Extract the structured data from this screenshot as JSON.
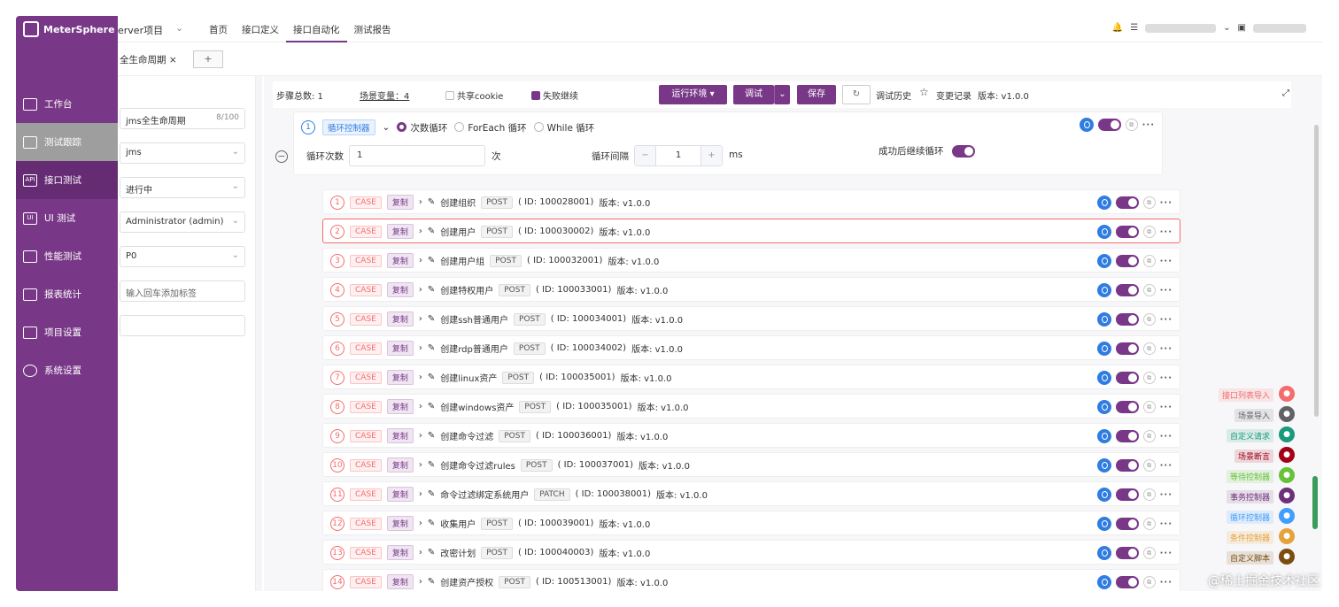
{
  "app": {
    "name": "MeterSphere"
  },
  "header": {
    "project": "erver项目",
    "nav": [
      "首页",
      "接口定义",
      "接口自动化",
      "测试报告"
    ],
    "active_nav": "接口自动化"
  },
  "tabs": {
    "current": "全生命周期 ×",
    "add": "+"
  },
  "sidebar": {
    "items": [
      {
        "label": "工作台",
        "icon": "desktop-icon"
      },
      {
        "label": "测试跟踪",
        "icon": "document-icon"
      },
      {
        "label": "接口测试",
        "icon": "api-icon"
      },
      {
        "label": "UI 测试",
        "icon": "ui-icon"
      },
      {
        "label": "性能测试",
        "icon": "performance-icon"
      },
      {
        "label": "报表统计",
        "icon": "report-icon"
      },
      {
        "label": "项目设置",
        "icon": "folder-icon"
      },
      {
        "label": "系统设置",
        "icon": "gear-icon"
      }
    ]
  },
  "form": {
    "name": "jms全生命周期",
    "name_count": "8/100",
    "module": "jms",
    "status": "进行中",
    "principal": "Administrator (admin)",
    "level": "P0",
    "tag_placeholder": "输入回车添加标签"
  },
  "toolbar": {
    "steps": "步骤总数: 1",
    "variables": "场景变量：4",
    "share_cookie": "共享cookie",
    "fail_continue": "失败继续",
    "env": "运行环境 ▾",
    "debug": "调试",
    "save": "保存",
    "history": "调试历史",
    "changelog": "变更记录",
    "version": "版本: v1.0.0"
  },
  "loop": {
    "index": "1",
    "tag": "循环控制器",
    "mode_count": "次数循环",
    "mode_foreach": "ForEach 循环",
    "mode_while": "While 循环",
    "count_label": "循环次数",
    "count_value": "1",
    "count_unit": "次",
    "interval_label": "循环间隔",
    "interval_value": "1",
    "interval_unit": "ms",
    "continue_label": "成功后继续循环"
  },
  "steps": [
    {
      "n": "1",
      "name": "创建组织",
      "method": "POST",
      "id": "( ID: 100028001)",
      "ver": "版本: v1.0.0"
    },
    {
      "n": "2",
      "name": "创建用户",
      "method": "POST",
      "id": "( ID: 100030002)",
      "ver": "版本: v1.0.0"
    },
    {
      "n": "3",
      "name": "创建用户组",
      "method": "POST",
      "id": "( ID: 100032001)",
      "ver": "版本: v1.0.0"
    },
    {
      "n": "4",
      "name": "创建特权用户",
      "method": "POST",
      "id": "( ID: 100033001)",
      "ver": "版本: v1.0.0"
    },
    {
      "n": "5",
      "name": "创建ssh普通用户",
      "method": "POST",
      "id": "( ID: 100034001)",
      "ver": "版本: v1.0.0"
    },
    {
      "n": "6",
      "name": "创建rdp普通用户",
      "method": "POST",
      "id": "( ID: 100034002)",
      "ver": "版本: v1.0.0"
    },
    {
      "n": "7",
      "name": "创建linux资产",
      "method": "POST",
      "id": "( ID: 100035001)",
      "ver": "版本: v1.0.0"
    },
    {
      "n": "8",
      "name": "创建windows资产",
      "method": "POST",
      "id": "( ID: 100035001)",
      "ver": "版本: v1.0.0"
    },
    {
      "n": "9",
      "name": "创建命令过滤",
      "method": "POST",
      "id": "( ID: 100036001)",
      "ver": "版本: v1.0.0"
    },
    {
      "n": "10",
      "name": "创建命令过滤rules",
      "method": "POST",
      "id": "( ID: 100037001)",
      "ver": "版本: v1.0.0"
    },
    {
      "n": "11",
      "name": "命令过滤绑定系统用户",
      "method": "PATCH",
      "id": "( ID: 100038001)",
      "ver": "版本: v1.0.0"
    },
    {
      "n": "12",
      "name": "收集用户",
      "method": "POST",
      "id": "( ID: 100039001)",
      "ver": "版本: v1.0.0"
    },
    {
      "n": "13",
      "name": "改密计划",
      "method": "POST",
      "id": "( ID: 100040003)",
      "ver": "版本: v1.0.0"
    },
    {
      "n": "14",
      "name": "创建资产授权",
      "method": "POST",
      "id": "( ID: 100513001)",
      "ver": "版本: v1.0.0"
    }
  ],
  "step_tags": {
    "case": "CASE",
    "copy": "复制"
  },
  "float_buttons": [
    {
      "label": "接口列表导入",
      "color": "#f56c6c",
      "icon": "api-import-icon"
    },
    {
      "label": "场景导入",
      "color": "#606266",
      "icon": "scene-import-icon"
    },
    {
      "label": "自定义请求",
      "color": "#1a9a7d",
      "icon": "custom-request-icon"
    },
    {
      "label": "场景断言",
      "color": "#a30014",
      "icon": "assertion-icon"
    },
    {
      "label": "等待控制器",
      "color": "#67c23a",
      "icon": "wait-icon"
    },
    {
      "label": "事务控制器",
      "color": "#6d317c",
      "icon": "transaction-icon"
    },
    {
      "label": "循环控制器",
      "color": "#409eff",
      "icon": "loop-icon"
    },
    {
      "label": "条件控制器",
      "color": "#e6a23c",
      "icon": "condition-icon"
    },
    {
      "label": "自定义脚本",
      "color": "#7b4d12",
      "icon": "script-icon"
    }
  ],
  "watermark": "@稀土掘金技术社区"
}
